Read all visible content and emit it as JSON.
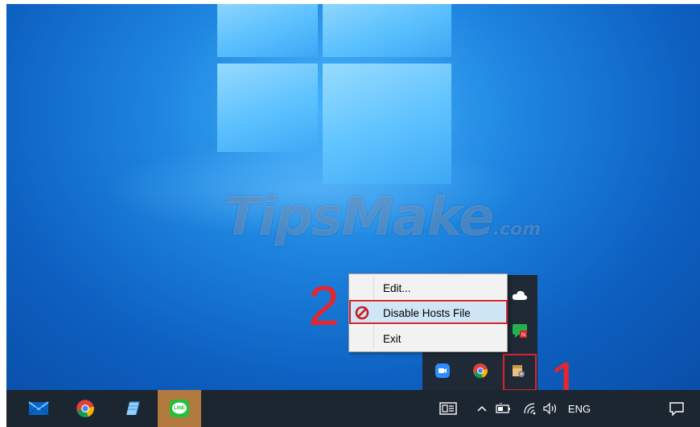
{
  "context_menu": {
    "items": [
      {
        "label": "Edit...",
        "icon": "none"
      },
      {
        "label": "Disable Hosts File",
        "icon": "prohibited-icon"
      },
      {
        "label": "Exit",
        "icon": "none"
      }
    ]
  },
  "annotations": {
    "step_tray": "1",
    "step_menu": "2",
    "highlight_color": "#d9242a"
  },
  "watermark": {
    "main": "TipsMake",
    "suffix": ".com"
  },
  "tray_flyout_icons": [
    "onedrive-cloud-icon",
    "chat-notification-icon",
    "zoom-icon",
    "chrome-icon",
    "hostsman-icon"
  ],
  "taskbar": {
    "pinned_icons": [
      "mail-icon",
      "chrome-icon",
      "notepad-icon",
      "line-app-icon"
    ],
    "line_label": "LINE",
    "language": "ENG",
    "tray_icons": [
      "news-widget-icon",
      "chevron-up-icon",
      "battery-icon",
      "wifi-icon",
      "volume-icon",
      "notification-center-icon"
    ]
  }
}
